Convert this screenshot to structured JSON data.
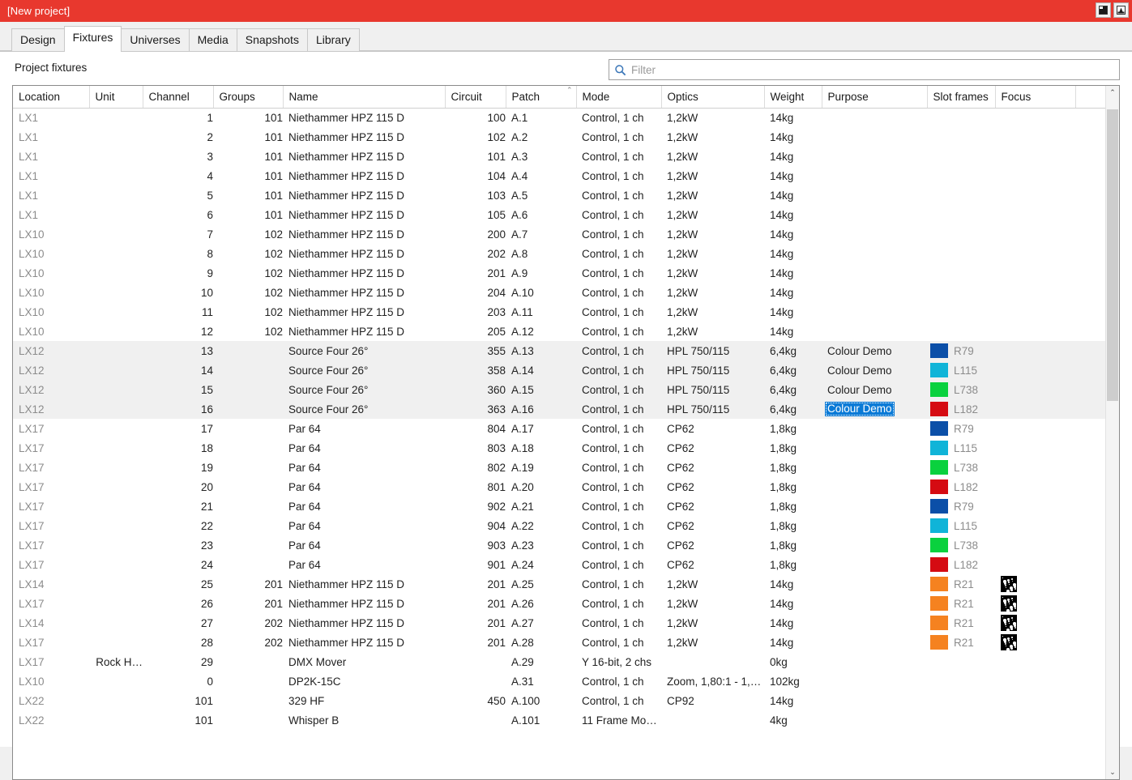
{
  "window": {
    "title": "[New project]",
    "accent_color": "#e8382e",
    "buttons": [
      {
        "name": "restore-down-button",
        "label": ""
      },
      {
        "name": "minimize-to-tray-button",
        "label": ""
      }
    ]
  },
  "tabs": [
    {
      "label": "Design",
      "active": false
    },
    {
      "label": "Fixtures",
      "active": true
    },
    {
      "label": "Universes",
      "active": false
    },
    {
      "label": "Media",
      "active": false
    },
    {
      "label": "Snapshots",
      "active": false
    },
    {
      "label": "Library",
      "active": false
    }
  ],
  "pane": {
    "title": "Project fixtures"
  },
  "search": {
    "placeholder": "Filter",
    "value": ""
  },
  "table": {
    "columns": [
      {
        "key": "location",
        "label": "Location",
        "sort": null
      },
      {
        "key": "unit",
        "label": "Unit",
        "sort": null
      },
      {
        "key": "channel",
        "label": "Channel",
        "sort": null
      },
      {
        "key": "groups",
        "label": "Groups",
        "sort": null
      },
      {
        "key": "name",
        "label": "Name",
        "sort": null
      },
      {
        "key": "circuit",
        "label": "Circuit",
        "sort": null
      },
      {
        "key": "patch",
        "label": "Patch",
        "sort": "asc"
      },
      {
        "key": "mode",
        "label": "Mode",
        "sort": null
      },
      {
        "key": "optics",
        "label": "Optics",
        "sort": null
      },
      {
        "key": "weight",
        "label": "Weight",
        "sort": null
      },
      {
        "key": "purpose",
        "label": "Purpose",
        "sort": null
      },
      {
        "key": "slotframes",
        "label": "Slot frames",
        "sort": null
      },
      {
        "key": "focus",
        "label": "Focus",
        "sort": null
      },
      {
        "key": "spacer",
        "label": "",
        "sort": null
      }
    ],
    "rows": [
      {
        "location": "LX1",
        "unit": "",
        "channel": "1",
        "groups": "101",
        "name": "Niethammer HPZ 115 D",
        "circuit": "100",
        "patch": "A.1",
        "mode": "Control, 1 ch",
        "optics": "1,2kW",
        "weight": "14kg",
        "purpose": "",
        "swatch": null,
        "swatch_label": "",
        "gobo": false,
        "highlight": false,
        "selected": false
      },
      {
        "location": "LX1",
        "unit": "",
        "channel": "2",
        "groups": "101",
        "name": "Niethammer HPZ 115 D",
        "circuit": "102",
        "patch": "A.2",
        "mode": "Control, 1 ch",
        "optics": "1,2kW",
        "weight": "14kg",
        "purpose": "",
        "swatch": null,
        "swatch_label": "",
        "gobo": false,
        "highlight": false,
        "selected": false
      },
      {
        "location": "LX1",
        "unit": "",
        "channel": "3",
        "groups": "101",
        "name": "Niethammer HPZ 115 D",
        "circuit": "101",
        "patch": "A.3",
        "mode": "Control, 1 ch",
        "optics": "1,2kW",
        "weight": "14kg",
        "purpose": "",
        "swatch": null,
        "swatch_label": "",
        "gobo": false,
        "highlight": false,
        "selected": false
      },
      {
        "location": "LX1",
        "unit": "",
        "channel": "4",
        "groups": "101",
        "name": "Niethammer HPZ 115 D",
        "circuit": "104",
        "patch": "A.4",
        "mode": "Control, 1 ch",
        "optics": "1,2kW",
        "weight": "14kg",
        "purpose": "",
        "swatch": null,
        "swatch_label": "",
        "gobo": false,
        "highlight": false,
        "selected": false
      },
      {
        "location": "LX1",
        "unit": "",
        "channel": "5",
        "groups": "101",
        "name": "Niethammer HPZ 115 D",
        "circuit": "103",
        "patch": "A.5",
        "mode": "Control, 1 ch",
        "optics": "1,2kW",
        "weight": "14kg",
        "purpose": "",
        "swatch": null,
        "swatch_label": "",
        "gobo": false,
        "highlight": false,
        "selected": false
      },
      {
        "location": "LX1",
        "unit": "",
        "channel": "6",
        "groups": "101",
        "name": "Niethammer HPZ 115 D",
        "circuit": "105",
        "patch": "A.6",
        "mode": "Control, 1 ch",
        "optics": "1,2kW",
        "weight": "14kg",
        "purpose": "",
        "swatch": null,
        "swatch_label": "",
        "gobo": false,
        "highlight": false,
        "selected": false
      },
      {
        "location": "LX10",
        "unit": "",
        "channel": "7",
        "groups": "102",
        "name": "Niethammer HPZ 115 D",
        "circuit": "200",
        "patch": "A.7",
        "mode": "Control, 1 ch",
        "optics": "1,2kW",
        "weight": "14kg",
        "purpose": "",
        "swatch": null,
        "swatch_label": "",
        "gobo": false,
        "highlight": false,
        "selected": false
      },
      {
        "location": "LX10",
        "unit": "",
        "channel": "8",
        "groups": "102",
        "name": "Niethammer HPZ 115 D",
        "circuit": "202",
        "patch": "A.8",
        "mode": "Control, 1 ch",
        "optics": "1,2kW",
        "weight": "14kg",
        "purpose": "",
        "swatch": null,
        "swatch_label": "",
        "gobo": false,
        "highlight": false,
        "selected": false
      },
      {
        "location": "LX10",
        "unit": "",
        "channel": "9",
        "groups": "102",
        "name": "Niethammer HPZ 115 D",
        "circuit": "201",
        "patch": "A.9",
        "mode": "Control, 1 ch",
        "optics": "1,2kW",
        "weight": "14kg",
        "purpose": "",
        "swatch": null,
        "swatch_label": "",
        "gobo": false,
        "highlight": false,
        "selected": false
      },
      {
        "location": "LX10",
        "unit": "",
        "channel": "10",
        "groups": "102",
        "name": "Niethammer HPZ 115 D",
        "circuit": "204",
        "patch": "A.10",
        "mode": "Control, 1 ch",
        "optics": "1,2kW",
        "weight": "14kg",
        "purpose": "",
        "swatch": null,
        "swatch_label": "",
        "gobo": false,
        "highlight": false,
        "selected": false
      },
      {
        "location": "LX10",
        "unit": "",
        "channel": "11",
        "groups": "102",
        "name": "Niethammer HPZ 115 D",
        "circuit": "203",
        "patch": "A.11",
        "mode": "Control, 1 ch",
        "optics": "1,2kW",
        "weight": "14kg",
        "purpose": "",
        "swatch": null,
        "swatch_label": "",
        "gobo": false,
        "highlight": false,
        "selected": false
      },
      {
        "location": "LX10",
        "unit": "",
        "channel": "12",
        "groups": "102",
        "name": "Niethammer HPZ 115 D",
        "circuit": "205",
        "patch": "A.12",
        "mode": "Control, 1 ch",
        "optics": "1,2kW",
        "weight": "14kg",
        "purpose": "",
        "swatch": null,
        "swatch_label": "",
        "gobo": false,
        "highlight": false,
        "selected": false
      },
      {
        "location": "LX12",
        "unit": "",
        "channel": "13",
        "groups": "",
        "name": "Source Four 26°",
        "circuit": "355",
        "patch": "A.13",
        "mode": "Control, 1 ch",
        "optics": "HPL 750/115",
        "weight": "6,4kg",
        "purpose": "Colour Demo",
        "swatch": "#0b4fa8",
        "swatch_label": "R79",
        "gobo": false,
        "highlight": true,
        "selected": false
      },
      {
        "location": "LX12",
        "unit": "",
        "channel": "14",
        "groups": "",
        "name": "Source Four 26°",
        "circuit": "358",
        "patch": "A.14",
        "mode": "Control, 1 ch",
        "optics": "HPL 750/115",
        "weight": "6,4kg",
        "purpose": "Colour Demo",
        "swatch": "#10b4d8",
        "swatch_label": "L115",
        "gobo": false,
        "highlight": true,
        "selected": false
      },
      {
        "location": "LX12",
        "unit": "",
        "channel": "15",
        "groups": "",
        "name": "Source Four 26°",
        "circuit": "360",
        "patch": "A.15",
        "mode": "Control, 1 ch",
        "optics": "HPL 750/115",
        "weight": "6,4kg",
        "purpose": "Colour Demo",
        "swatch": "#0ad13e",
        "swatch_label": "L738",
        "gobo": false,
        "highlight": true,
        "selected": false
      },
      {
        "location": "LX12",
        "unit": "",
        "channel": "16",
        "groups": "",
        "name": "Source Four 26°",
        "circuit": "363",
        "patch": "A.16",
        "mode": "Control, 1 ch",
        "optics": "HPL 750/115",
        "weight": "6,4kg",
        "purpose": "Colour Demo",
        "swatch": "#d50b12",
        "swatch_label": "L182",
        "gobo": false,
        "highlight": true,
        "selected": true
      },
      {
        "location": "LX17",
        "unit": "",
        "channel": "17",
        "groups": "",
        "name": "Par 64",
        "circuit": "804",
        "patch": "A.17",
        "mode": "Control, 1 ch",
        "optics": "CP62",
        "weight": "1,8kg",
        "purpose": "",
        "swatch": "#0b4fa8",
        "swatch_label": "R79",
        "gobo": false,
        "highlight": false,
        "selected": false
      },
      {
        "location": "LX17",
        "unit": "",
        "channel": "18",
        "groups": "",
        "name": "Par 64",
        "circuit": "803",
        "patch": "A.18",
        "mode": "Control, 1 ch",
        "optics": "CP62",
        "weight": "1,8kg",
        "purpose": "",
        "swatch": "#10b4d8",
        "swatch_label": "L115",
        "gobo": false,
        "highlight": false,
        "selected": false
      },
      {
        "location": "LX17",
        "unit": "",
        "channel": "19",
        "groups": "",
        "name": "Par 64",
        "circuit": "802",
        "patch": "A.19",
        "mode": "Control, 1 ch",
        "optics": "CP62",
        "weight": "1,8kg",
        "purpose": "",
        "swatch": "#0ad13e",
        "swatch_label": "L738",
        "gobo": false,
        "highlight": false,
        "selected": false
      },
      {
        "location": "LX17",
        "unit": "",
        "channel": "20",
        "groups": "",
        "name": "Par 64",
        "circuit": "801",
        "patch": "A.20",
        "mode": "Control, 1 ch",
        "optics": "CP62",
        "weight": "1,8kg",
        "purpose": "",
        "swatch": "#d50b12",
        "swatch_label": "L182",
        "gobo": false,
        "highlight": false,
        "selected": false
      },
      {
        "location": "LX17",
        "unit": "",
        "channel": "21",
        "groups": "",
        "name": "Par 64",
        "circuit": "902",
        "patch": "A.21",
        "mode": "Control, 1 ch",
        "optics": "CP62",
        "weight": "1,8kg",
        "purpose": "",
        "swatch": "#0b4fa8",
        "swatch_label": "R79",
        "gobo": false,
        "highlight": false,
        "selected": false
      },
      {
        "location": "LX17",
        "unit": "",
        "channel": "22",
        "groups": "",
        "name": "Par 64",
        "circuit": "904",
        "patch": "A.22",
        "mode": "Control, 1 ch",
        "optics": "CP62",
        "weight": "1,8kg",
        "purpose": "",
        "swatch": "#10b4d8",
        "swatch_label": "L115",
        "gobo": false,
        "highlight": false,
        "selected": false
      },
      {
        "location": "LX17",
        "unit": "",
        "channel": "23",
        "groups": "",
        "name": "Par 64",
        "circuit": "903",
        "patch": "A.23",
        "mode": "Control, 1 ch",
        "optics": "CP62",
        "weight": "1,8kg",
        "purpose": "",
        "swatch": "#0ad13e",
        "swatch_label": "L738",
        "gobo": false,
        "highlight": false,
        "selected": false
      },
      {
        "location": "LX17",
        "unit": "",
        "channel": "24",
        "groups": "",
        "name": "Par 64",
        "circuit": "901",
        "patch": "A.24",
        "mode": "Control, 1 ch",
        "optics": "CP62",
        "weight": "1,8kg",
        "purpose": "",
        "swatch": "#d50b12",
        "swatch_label": "L182",
        "gobo": false,
        "highlight": false,
        "selected": false
      },
      {
        "location": "LX14",
        "unit": "",
        "channel": "25",
        "groups": "201",
        "name": "Niethammer HPZ 115 D",
        "circuit": "201",
        "patch": "A.25",
        "mode": "Control, 1 ch",
        "optics": "1,2kW",
        "weight": "14kg",
        "purpose": "",
        "swatch": "#f58220",
        "swatch_label": "R21",
        "gobo": true,
        "highlight": false,
        "selected": false
      },
      {
        "location": "LX17",
        "unit": "",
        "channel": "26",
        "groups": "201",
        "name": "Niethammer HPZ 115 D",
        "circuit": "201",
        "patch": "A.26",
        "mode": "Control, 1 ch",
        "optics": "1,2kW",
        "weight": "14kg",
        "purpose": "",
        "swatch": "#f58220",
        "swatch_label": "R21",
        "gobo": true,
        "highlight": false,
        "selected": false
      },
      {
        "location": "LX14",
        "unit": "",
        "channel": "27",
        "groups": "202",
        "name": "Niethammer HPZ 115 D",
        "circuit": "201",
        "patch": "A.27",
        "mode": "Control, 1 ch",
        "optics": "1,2kW",
        "weight": "14kg",
        "purpose": "",
        "swatch": "#f58220",
        "swatch_label": "R21",
        "gobo": true,
        "highlight": false,
        "selected": false
      },
      {
        "location": "LX17",
        "unit": "",
        "channel": "28",
        "groups": "202",
        "name": "Niethammer HPZ 115 D",
        "circuit": "201",
        "patch": "A.28",
        "mode": "Control, 1 ch",
        "optics": "1,2kW",
        "weight": "14kg",
        "purpose": "",
        "swatch": "#f58220",
        "swatch_label": "R21",
        "gobo": true,
        "highlight": false,
        "selected": false
      },
      {
        "location": "LX17",
        "unit": "Rock H…",
        "channel": "29",
        "groups": "",
        "name": "DMX Mover",
        "circuit": "",
        "patch": "A.29",
        "mode": "Y 16-bit, 2 chs",
        "optics": "",
        "weight": "0kg",
        "purpose": "",
        "swatch": null,
        "swatch_label": "",
        "gobo": false,
        "highlight": false,
        "selected": false
      },
      {
        "location": "LX10",
        "unit": "",
        "channel": "0",
        "groups": "",
        "name": "DP2K-15C",
        "circuit": "",
        "patch": "A.31",
        "mode": "Control, 1 ch",
        "optics": "Zoom, 1,80:1 - 1,…",
        "weight": "102kg",
        "purpose": "",
        "swatch": null,
        "swatch_label": "",
        "gobo": false,
        "highlight": false,
        "selected": false
      },
      {
        "location": "LX22",
        "unit": "",
        "channel": "101",
        "groups": "",
        "name": "329 HF",
        "circuit": "450",
        "patch": "A.100",
        "mode": "Control, 1 ch",
        "optics": "CP92",
        "weight": "14kg",
        "purpose": "",
        "swatch": null,
        "swatch_label": "",
        "gobo": false,
        "highlight": false,
        "selected": false
      },
      {
        "location": "LX22",
        "unit": "",
        "channel": "101",
        "groups": "",
        "name": "Whisper B",
        "circuit": "",
        "patch": "A.101",
        "mode": "11 Frame Mo…",
        "optics": "",
        "weight": "4kg",
        "purpose": "",
        "swatch": null,
        "swatch_label": "",
        "gobo": false,
        "highlight": false,
        "selected": false
      }
    ]
  },
  "scrollbar": {
    "up_arrow": "⌃",
    "down_arrow": "⌄"
  }
}
